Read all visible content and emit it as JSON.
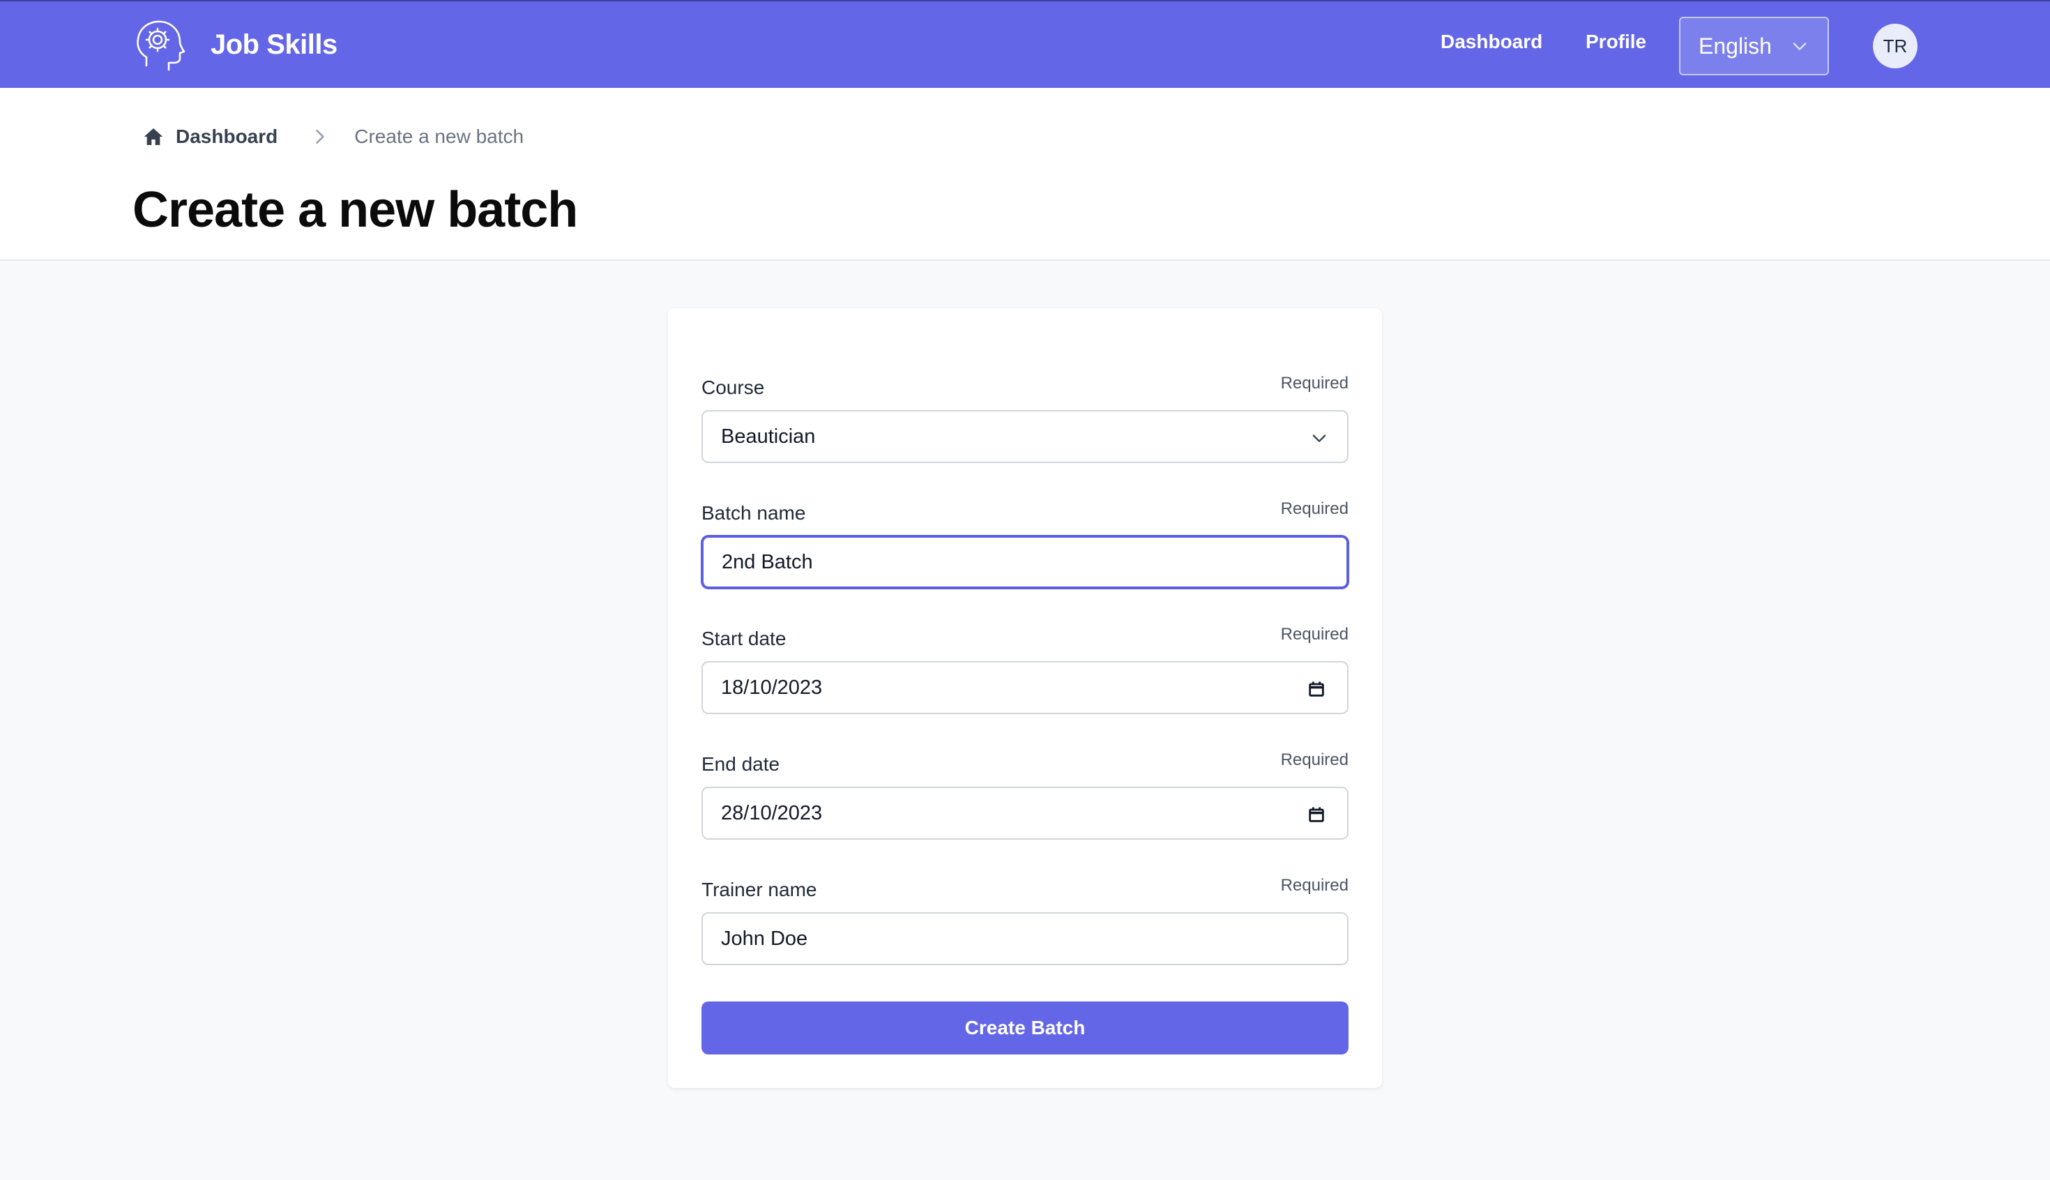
{
  "app": {
    "name": "Job Skills",
    "logo_icon": "head-gear-icon"
  },
  "nav": {
    "dashboard": "Dashboard",
    "profile": "Profile",
    "language": "English",
    "avatar_initials": "TR"
  },
  "breadcrumb": {
    "home": "Dashboard",
    "current": "Create a new batch"
  },
  "page": {
    "title": "Create a new batch"
  },
  "form": {
    "required_text": "Required",
    "fields": [
      {
        "label": "Course",
        "value": "Beautician",
        "type": "select"
      },
      {
        "label": "Batch name",
        "value": "2nd Batch",
        "type": "text",
        "focused": true
      },
      {
        "label": "Start date",
        "value": "18/10/2023",
        "type": "date"
      },
      {
        "label": "End date",
        "value": "28/10/2023",
        "type": "date"
      },
      {
        "label": "Trainer name",
        "value": "John Doe",
        "type": "text"
      }
    ],
    "submit": "Create Batch"
  },
  "colors": {
    "brand": "#6366e6",
    "focus": "#5b5fdf",
    "background": "#f8f9fb"
  }
}
